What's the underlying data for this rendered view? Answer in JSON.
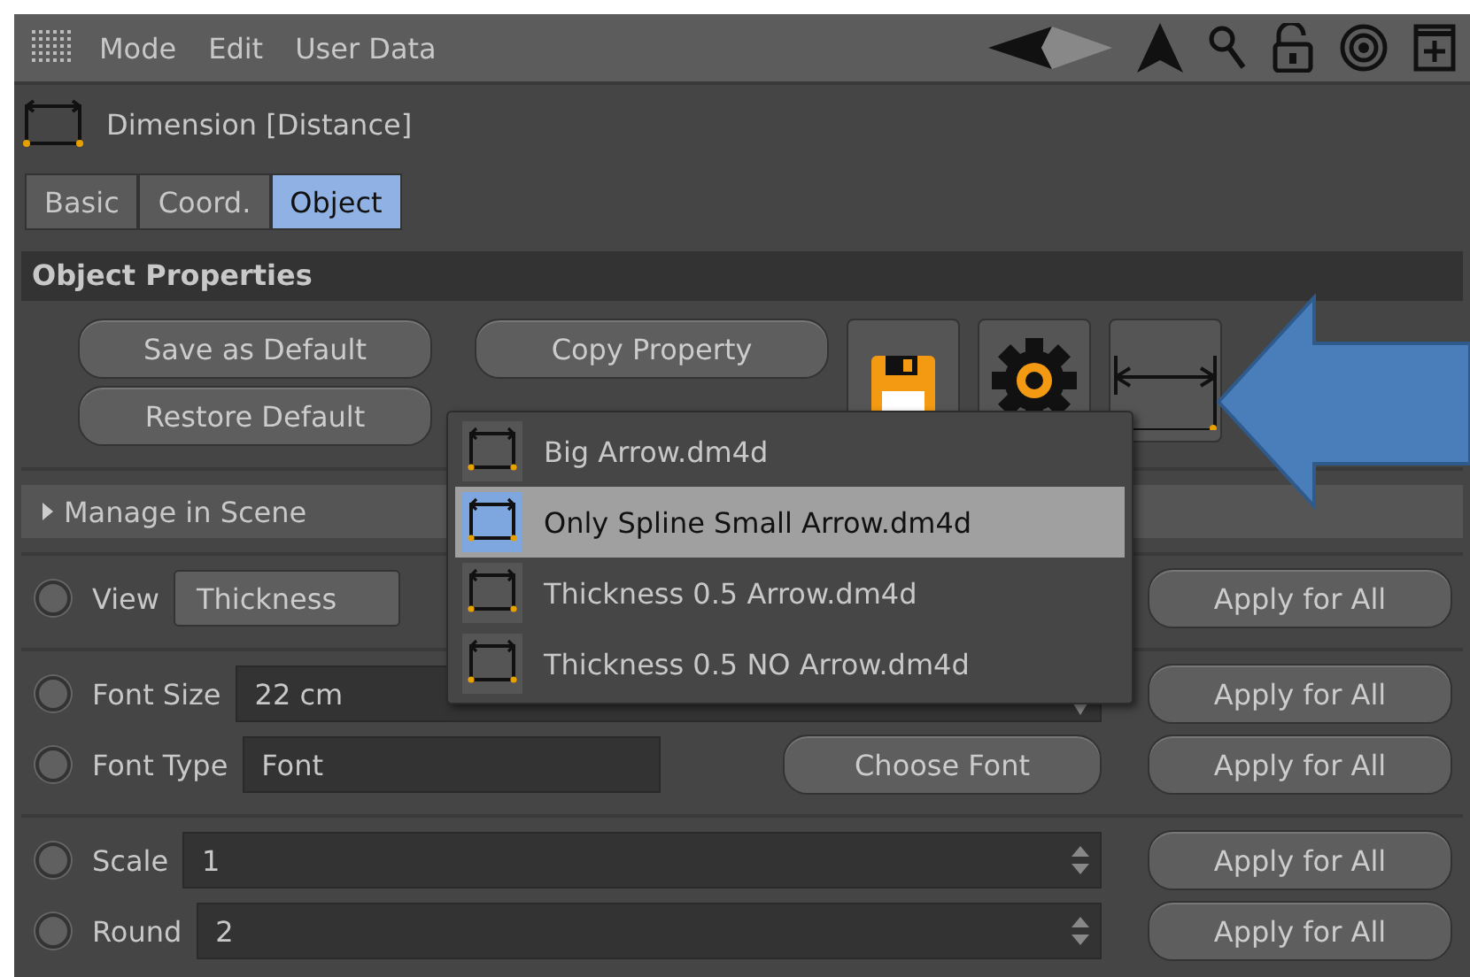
{
  "menu": [
    "Mode",
    "Edit",
    "User Data"
  ],
  "object_title": "Dimension [Distance]",
  "tabs": [
    {
      "label": "Basic",
      "selected": false
    },
    {
      "label": "Coord.",
      "selected": false
    },
    {
      "label": "Object",
      "selected": true
    }
  ],
  "section": "Object Properties",
  "buttons": {
    "save_default": "Save as Default",
    "restore_default": "Restore Default",
    "copy_property": "Copy Property"
  },
  "preset_menu": [
    {
      "label": "Big Arrow.dm4d",
      "selected": false
    },
    {
      "label": "Only Spline Small Arrow.dm4d",
      "selected": true
    },
    {
      "label": "Thickness 0.5 Arrow.dm4d",
      "selected": false
    },
    {
      "label": "Thickness 0.5 NO Arrow.dm4d",
      "selected": false
    }
  ],
  "group": {
    "label": "Manage in Scene",
    "expanded": false
  },
  "row_groups": [
    [
      {
        "kind": "dropdown",
        "checked": false,
        "label": "View",
        "value": "Thickness",
        "apply": "Apply for All"
      }
    ],
    [
      {
        "kind": "select",
        "checked": false,
        "label": "Font Size",
        "value": "22 cm",
        "apply": "Apply for All"
      },
      {
        "kind": "font",
        "checked": false,
        "label": "Font Type",
        "value": "Font",
        "button": "Choose Font",
        "apply": "Apply for All"
      }
    ],
    [
      {
        "kind": "number",
        "checked": false,
        "label": "Scale",
        "value": "1",
        "apply": "Apply for All"
      },
      {
        "kind": "number",
        "checked": false,
        "label": "Round",
        "value": "2",
        "apply": "Apply for All"
      }
    ]
  ]
}
